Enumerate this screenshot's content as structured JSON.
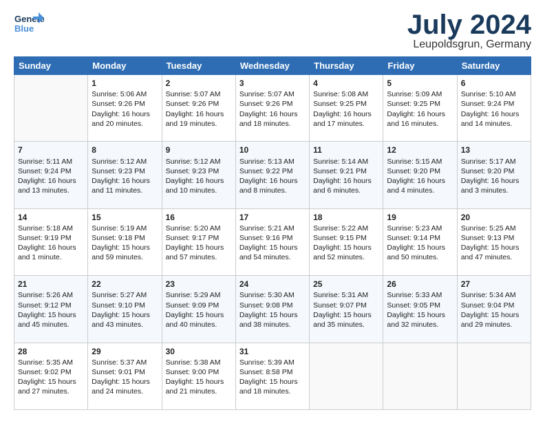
{
  "header": {
    "logo_general": "General",
    "logo_blue": "Blue",
    "month": "July 2024",
    "location": "Leupoldsgrun, Germany"
  },
  "weekdays": [
    "Sunday",
    "Monday",
    "Tuesday",
    "Wednesday",
    "Thursday",
    "Friday",
    "Saturday"
  ],
  "weeks": [
    [
      {
        "day": "",
        "info": ""
      },
      {
        "day": "1",
        "info": "Sunrise: 5:06 AM\nSunset: 9:26 PM\nDaylight: 16 hours\nand 20 minutes."
      },
      {
        "day": "2",
        "info": "Sunrise: 5:07 AM\nSunset: 9:26 PM\nDaylight: 16 hours\nand 19 minutes."
      },
      {
        "day": "3",
        "info": "Sunrise: 5:07 AM\nSunset: 9:26 PM\nDaylight: 16 hours\nand 18 minutes."
      },
      {
        "day": "4",
        "info": "Sunrise: 5:08 AM\nSunset: 9:25 PM\nDaylight: 16 hours\nand 17 minutes."
      },
      {
        "day": "5",
        "info": "Sunrise: 5:09 AM\nSunset: 9:25 PM\nDaylight: 16 hours\nand 16 minutes."
      },
      {
        "day": "6",
        "info": "Sunrise: 5:10 AM\nSunset: 9:24 PM\nDaylight: 16 hours\nand 14 minutes."
      }
    ],
    [
      {
        "day": "7",
        "info": "Sunrise: 5:11 AM\nSunset: 9:24 PM\nDaylight: 16 hours\nand 13 minutes."
      },
      {
        "day": "8",
        "info": "Sunrise: 5:12 AM\nSunset: 9:23 PM\nDaylight: 16 hours\nand 11 minutes."
      },
      {
        "day": "9",
        "info": "Sunrise: 5:12 AM\nSunset: 9:23 PM\nDaylight: 16 hours\nand 10 minutes."
      },
      {
        "day": "10",
        "info": "Sunrise: 5:13 AM\nSunset: 9:22 PM\nDaylight: 16 hours\nand 8 minutes."
      },
      {
        "day": "11",
        "info": "Sunrise: 5:14 AM\nSunset: 9:21 PM\nDaylight: 16 hours\nand 6 minutes."
      },
      {
        "day": "12",
        "info": "Sunrise: 5:15 AM\nSunset: 9:20 PM\nDaylight: 16 hours\nand 4 minutes."
      },
      {
        "day": "13",
        "info": "Sunrise: 5:17 AM\nSunset: 9:20 PM\nDaylight: 16 hours\nand 3 minutes."
      }
    ],
    [
      {
        "day": "14",
        "info": "Sunrise: 5:18 AM\nSunset: 9:19 PM\nDaylight: 16 hours\nand 1 minute."
      },
      {
        "day": "15",
        "info": "Sunrise: 5:19 AM\nSunset: 9:18 PM\nDaylight: 15 hours\nand 59 minutes."
      },
      {
        "day": "16",
        "info": "Sunrise: 5:20 AM\nSunset: 9:17 PM\nDaylight: 15 hours\nand 57 minutes."
      },
      {
        "day": "17",
        "info": "Sunrise: 5:21 AM\nSunset: 9:16 PM\nDaylight: 15 hours\nand 54 minutes."
      },
      {
        "day": "18",
        "info": "Sunrise: 5:22 AM\nSunset: 9:15 PM\nDaylight: 15 hours\nand 52 minutes."
      },
      {
        "day": "19",
        "info": "Sunrise: 5:23 AM\nSunset: 9:14 PM\nDaylight: 15 hours\nand 50 minutes."
      },
      {
        "day": "20",
        "info": "Sunrise: 5:25 AM\nSunset: 9:13 PM\nDaylight: 15 hours\nand 47 minutes."
      }
    ],
    [
      {
        "day": "21",
        "info": "Sunrise: 5:26 AM\nSunset: 9:12 PM\nDaylight: 15 hours\nand 45 minutes."
      },
      {
        "day": "22",
        "info": "Sunrise: 5:27 AM\nSunset: 9:10 PM\nDaylight: 15 hours\nand 43 minutes."
      },
      {
        "day": "23",
        "info": "Sunrise: 5:29 AM\nSunset: 9:09 PM\nDaylight: 15 hours\nand 40 minutes."
      },
      {
        "day": "24",
        "info": "Sunrise: 5:30 AM\nSunset: 9:08 PM\nDaylight: 15 hours\nand 38 minutes."
      },
      {
        "day": "25",
        "info": "Sunrise: 5:31 AM\nSunset: 9:07 PM\nDaylight: 15 hours\nand 35 minutes."
      },
      {
        "day": "26",
        "info": "Sunrise: 5:33 AM\nSunset: 9:05 PM\nDaylight: 15 hours\nand 32 minutes."
      },
      {
        "day": "27",
        "info": "Sunrise: 5:34 AM\nSunset: 9:04 PM\nDaylight: 15 hours\nand 29 minutes."
      }
    ],
    [
      {
        "day": "28",
        "info": "Sunrise: 5:35 AM\nSunset: 9:02 PM\nDaylight: 15 hours\nand 27 minutes."
      },
      {
        "day": "29",
        "info": "Sunrise: 5:37 AM\nSunset: 9:01 PM\nDaylight: 15 hours\nand 24 minutes."
      },
      {
        "day": "30",
        "info": "Sunrise: 5:38 AM\nSunset: 9:00 PM\nDaylight: 15 hours\nand 21 minutes."
      },
      {
        "day": "31",
        "info": "Sunrise: 5:39 AM\nSunset: 8:58 PM\nDaylight: 15 hours\nand 18 minutes."
      },
      {
        "day": "",
        "info": ""
      },
      {
        "day": "",
        "info": ""
      },
      {
        "day": "",
        "info": ""
      }
    ]
  ]
}
